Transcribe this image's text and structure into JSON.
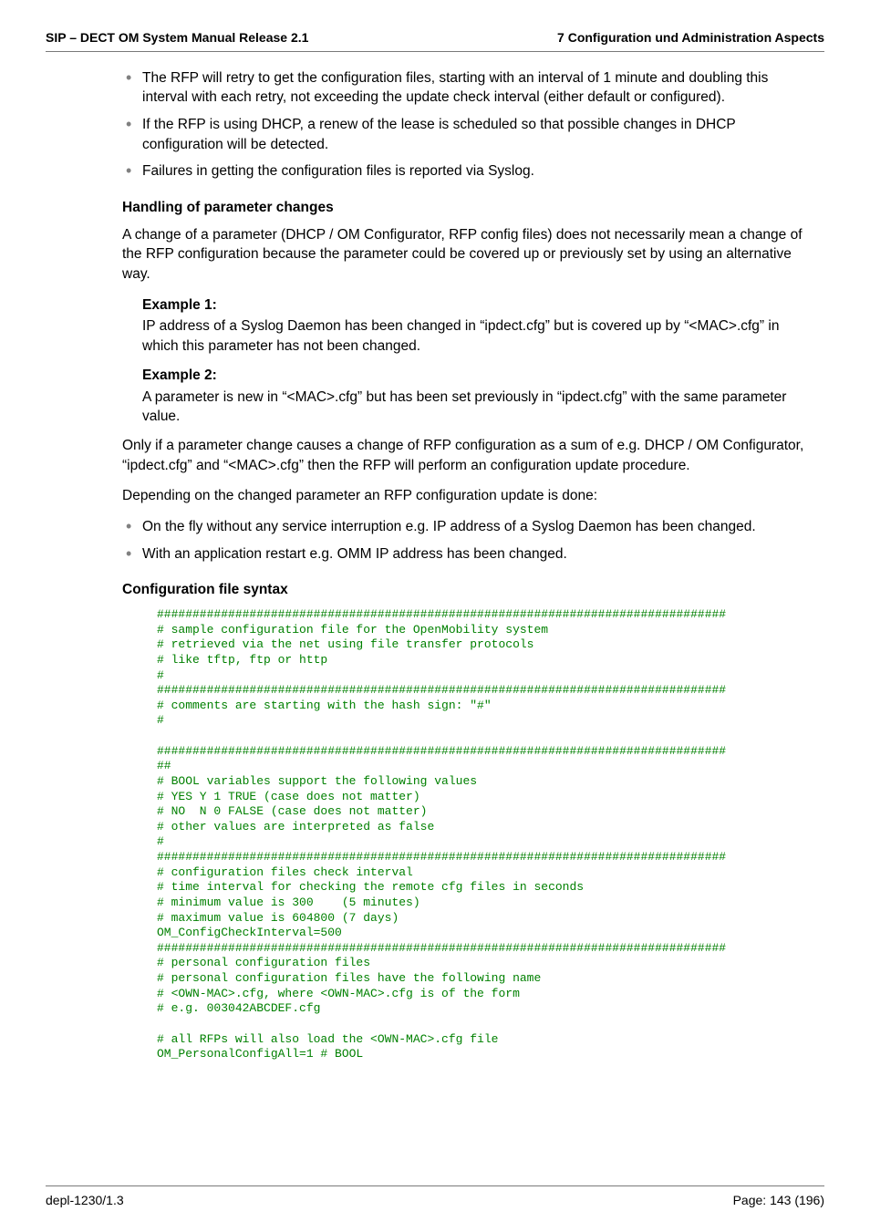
{
  "header": {
    "left": "SIP – DECT OM System Manual Release 2.1",
    "right": "7 Configuration und Administration Aspects"
  },
  "top_bullets": [
    "The RFP will retry to get the configuration files, starting with an interval of 1 minute and doubling this interval with each retry, not exceeding the update check interval (either default or configured).",
    "If the RFP is using DHCP, a renew of the lease is scheduled so that possible changes in DHCP configuration will be detected.",
    "Failures in getting the configuration files is reported via Syslog."
  ],
  "sections": {
    "handling_heading": "Handling of parameter changes",
    "handling_intro": "A change of a parameter (DHCP / OM Configurator, RFP config files) does not necessarily mean a change of the RFP configuration because the parameter could be covered up or previously set by using an alternative way.",
    "example1_title": "Example 1:",
    "example1_body": "IP address of a Syslog Daemon has been changed in “ipdect.cfg” but is covered up by “<MAC>.cfg” in which this parameter has not been changed.",
    "example2_title": "Example 2:",
    "example2_body": "A parameter is new in “<MAC>.cfg” but has been set previously in “ipdect.cfg” with the same parameter value.",
    "only_if_para": "Only if a parameter change causes a change of RFP configuration as a sum of e.g. DHCP / OM Configurator, “ipdect.cfg” and “<MAC>.cfg” then the RFP will perform an configuration update procedure.",
    "depending_para": "Depending on the changed parameter an RFP configuration update is done:",
    "depending_bullets": [
      "On the fly without any service interruption e.g. IP address of a Syslog Daemon has been changed.",
      "With an application restart e.g. OMM IP address has been changed."
    ],
    "syntax_heading": "Configuration file syntax"
  },
  "code": "################################################################################\n# sample configuration file for the OpenMobility system\n# retrieved via the net using file transfer protocols\n# like tftp, ftp or http\n#\n################################################################################\n# comments are starting with the hash sign: \"#\"\n#\n\n################################################################################\n##\n# BOOL variables support the following values\n# YES Y 1 TRUE (case does not matter)\n# NO  N 0 FALSE (case does not matter)\n# other values are interpreted as false\n#\n################################################################################\n# configuration files check interval\n# time interval for checking the remote cfg files in seconds\n# minimum value is 300    (5 minutes)\n# maximum value is 604800 (7 days)\nOM_ConfigCheckInterval=500\n################################################################################\n# personal configuration files\n# personal configuration files have the following name\n# <OWN-MAC>.cfg, where <OWN-MAC>.cfg is of the form\n# e.g. 003042ABCDEF.cfg\n\n# all RFPs will also load the <OWN-MAC>.cfg file\nOM_PersonalConfigAll=1 # BOOL",
  "footer": {
    "left": "depl-1230/1.3",
    "right": "Page: 143 (196)"
  }
}
